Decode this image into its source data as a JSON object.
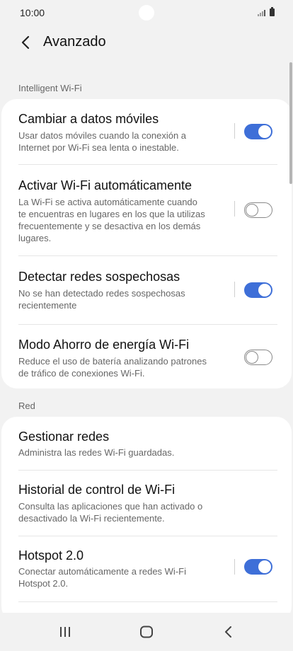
{
  "status": {
    "time": "10:00"
  },
  "header": {
    "title": "Avanzado"
  },
  "sections": {
    "intelligent": "Intelligent Wi-Fi",
    "red": "Red"
  },
  "intelligent_items": [
    {
      "title": "Cambiar a datos móviles",
      "lines": [
        "Usar datos móviles cuando la conexión a",
        "Internet por Wi-Fi sea lenta o inestable."
      ],
      "toggle": "on"
    },
    {
      "title": "Activar Wi-Fi automáticamente",
      "lines": [
        "La Wi-Fi se activa automáticamente cuando",
        "te encuentras en lugares en los que la utilizas",
        "frecuentemente y se desactiva en los demás",
        "lugares."
      ],
      "toggle": "off"
    },
    {
      "title": "Detectar redes sospechosas",
      "lines": [
        "No se han detectado redes sospechosas",
        "recientemente"
      ],
      "toggle": "on"
    },
    {
      "title": "Modo Ahorro de energía Wi-Fi",
      "lines": [
        "Reduce el uso de batería analizando patrones",
        "de tráfico de conexiones Wi-Fi."
      ],
      "toggle": "off"
    }
  ],
  "red_items": [
    {
      "title": "Gestionar redes",
      "lines": [
        "Administra las redes Wi-Fi guardadas."
      ]
    },
    {
      "title": "Historial de control de Wi-Fi",
      "lines": [
        "Consulta las aplicaciones que han activado o",
        "desactivado la Wi-Fi recientemente."
      ]
    },
    {
      "title": "Hotspot 2.0",
      "lines": [
        "Conectar automáticamente a redes Wi-Fi",
        "Hotspot 2.0."
      ],
      "toggle": "on"
    }
  ],
  "icons": {
    "back": "chevron-left-icon",
    "recents": "recent-apps-icon",
    "home": "home-icon",
    "nav_back": "nav-back-icon"
  },
  "colors": {
    "accent": "#3e6fd8",
    "background": "#f2f2f2",
    "card": "#ffffff"
  }
}
